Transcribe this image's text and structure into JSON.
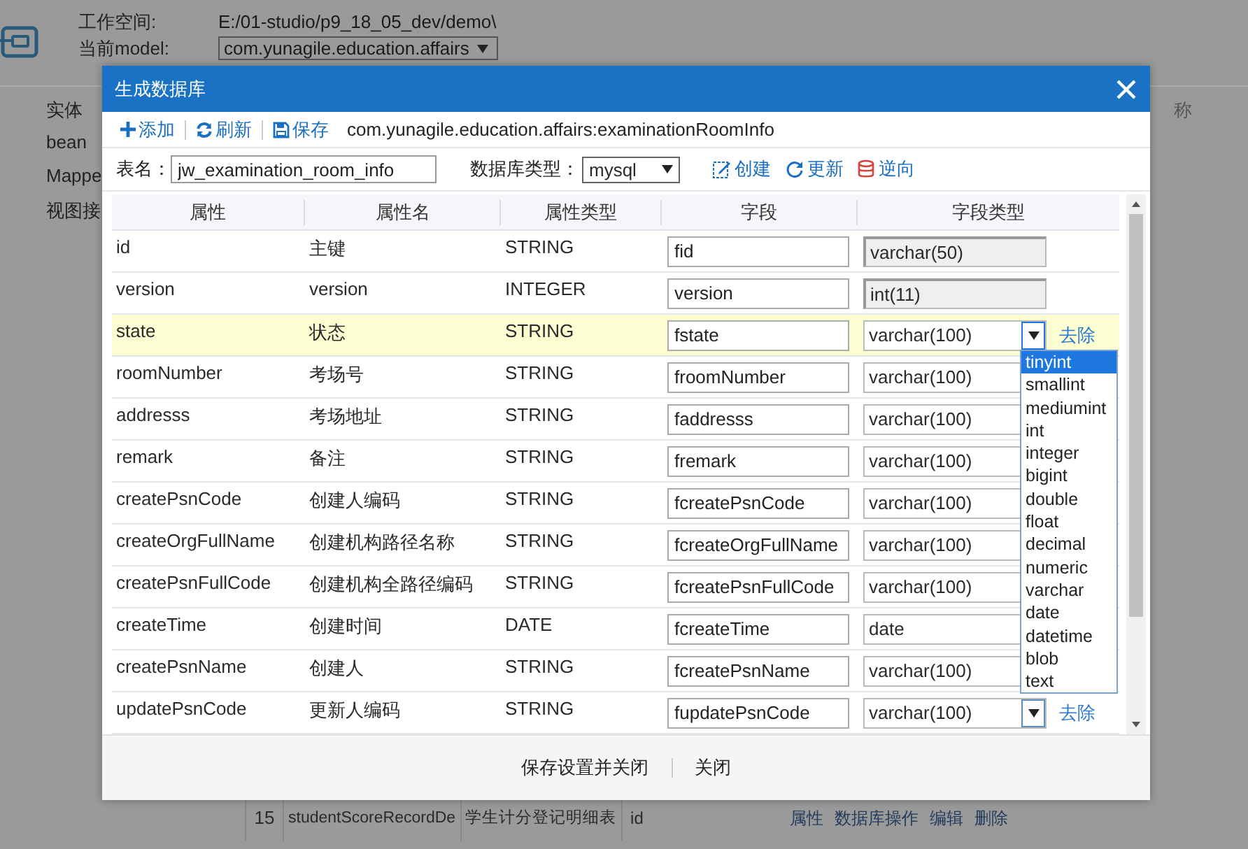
{
  "workspace": {
    "label": "工作空间:",
    "value": "E:/01-studio/p9_18_05_dev/demo\\"
  },
  "model": {
    "label": "当前model:",
    "value": "com.yunagile.education.affairs"
  },
  "sidebar": {
    "items": [
      "实体",
      "bean",
      "Mappe",
      "视图接"
    ]
  },
  "background_table": {
    "header_fragment": "称",
    "row": {
      "index": "15",
      "name": "studentScoreRecordDe",
      "title": "学生计分登记明细表",
      "key": "id",
      "actions": [
        "属性",
        "数据库操作",
        "编辑",
        "删除"
      ]
    }
  },
  "dialog": {
    "title": "生成数据库",
    "toolbar": [
      {
        "label": "添加",
        "kind": "add"
      },
      {
        "label": "刷新",
        "kind": "refresh"
      },
      {
        "label": "保存",
        "kind": "save"
      }
    ],
    "model_path": "com.yunagile.education.affairs:examinationRoomInfo",
    "table_name": {
      "label": "表名：",
      "value": "jw_examination_room_info"
    },
    "db_type": {
      "label": "数据库类型：",
      "value": "mysql"
    },
    "actions": [
      {
        "label": "创建",
        "kind": "create"
      },
      {
        "label": "更新",
        "kind": "update"
      },
      {
        "label": "逆向",
        "kind": "reverse"
      }
    ],
    "columns": [
      "属性",
      "属性名",
      "属性类型",
      "字段",
      "字段类型"
    ],
    "rows": [
      {
        "attribute": "id",
        "name": "主键",
        "type": "STRING",
        "field": "fid",
        "field_type": "varchar(50)",
        "readonly": true,
        "selected": false
      },
      {
        "attribute": "version",
        "name": "version",
        "type": "INTEGER",
        "field": "version",
        "field_type": "int(11)",
        "readonly": true,
        "selected": false
      },
      {
        "attribute": "state",
        "name": "状态",
        "type": "STRING",
        "field": "fstate",
        "field_type": "varchar(100)",
        "readonly": false,
        "selected": true,
        "remove": "去除",
        "expanded": true
      },
      {
        "attribute": "roomNumber",
        "name": "考场号",
        "type": "STRING",
        "field": "froomNumber",
        "field_type": "varchar(100)",
        "readonly": false,
        "selected": false
      },
      {
        "attribute": "addresss",
        "name": "考场地址",
        "type": "STRING",
        "field": "faddresss",
        "field_type": "varchar(100)",
        "readonly": false,
        "selected": false
      },
      {
        "attribute": "remark",
        "name": "备注",
        "type": "STRING",
        "field": "fremark",
        "field_type": "varchar(100)",
        "readonly": false,
        "selected": false
      },
      {
        "attribute": "createPsnCode",
        "name": "创建人编码",
        "type": "STRING",
        "field": "fcreatePsnCode",
        "field_type": "varchar(100)",
        "readonly": false,
        "selected": false
      },
      {
        "attribute": "createOrgFullName",
        "name": "创建机构路径名称",
        "type": "STRING",
        "field": "fcreateOrgFullName",
        "field_type": "varchar(100)",
        "readonly": false,
        "selected": false
      },
      {
        "attribute": "createPsnFullCode",
        "name": "创建机构全路径编码",
        "type": "STRING",
        "field": "fcreatePsnFullCode",
        "field_type": "varchar(100)",
        "readonly": false,
        "selected": false
      },
      {
        "attribute": "createTime",
        "name": "创建时间",
        "type": "DATE",
        "field": "fcreateTime",
        "field_type": "date",
        "readonly": false,
        "selected": false
      },
      {
        "attribute": "createPsnName",
        "name": "创建人",
        "type": "STRING",
        "field": "fcreatePsnName",
        "field_type": "varchar(100)",
        "readonly": false,
        "selected": false
      },
      {
        "attribute": "updatePsnCode",
        "name": "更新人编码",
        "type": "STRING",
        "field": "fupdatePsnCode",
        "field_type": "varchar(100)",
        "readonly": false,
        "selected": false,
        "remove": "去除",
        "expanded": false
      }
    ],
    "dropdown": {
      "options": [
        {
          "label": "tinyint",
          "selected": true
        },
        {
          "label": "smallint",
          "selected": false
        },
        {
          "label": "mediumint",
          "selected": false
        },
        {
          "label": "int",
          "selected": false
        },
        {
          "label": "integer",
          "selected": false
        },
        {
          "label": "bigint",
          "selected": false
        },
        {
          "label": "double",
          "selected": false
        },
        {
          "label": "float",
          "selected": false
        },
        {
          "label": "decimal",
          "selected": false
        },
        {
          "label": "numeric",
          "selected": false
        },
        {
          "label": "varchar",
          "selected": false
        },
        {
          "label": "date",
          "selected": false
        },
        {
          "label": "datetime",
          "selected": false
        },
        {
          "label": "blob",
          "selected": false
        },
        {
          "label": "text",
          "selected": false
        }
      ]
    },
    "footer": {
      "buttons": [
        "保存设置并关闭",
        "关闭"
      ]
    }
  }
}
